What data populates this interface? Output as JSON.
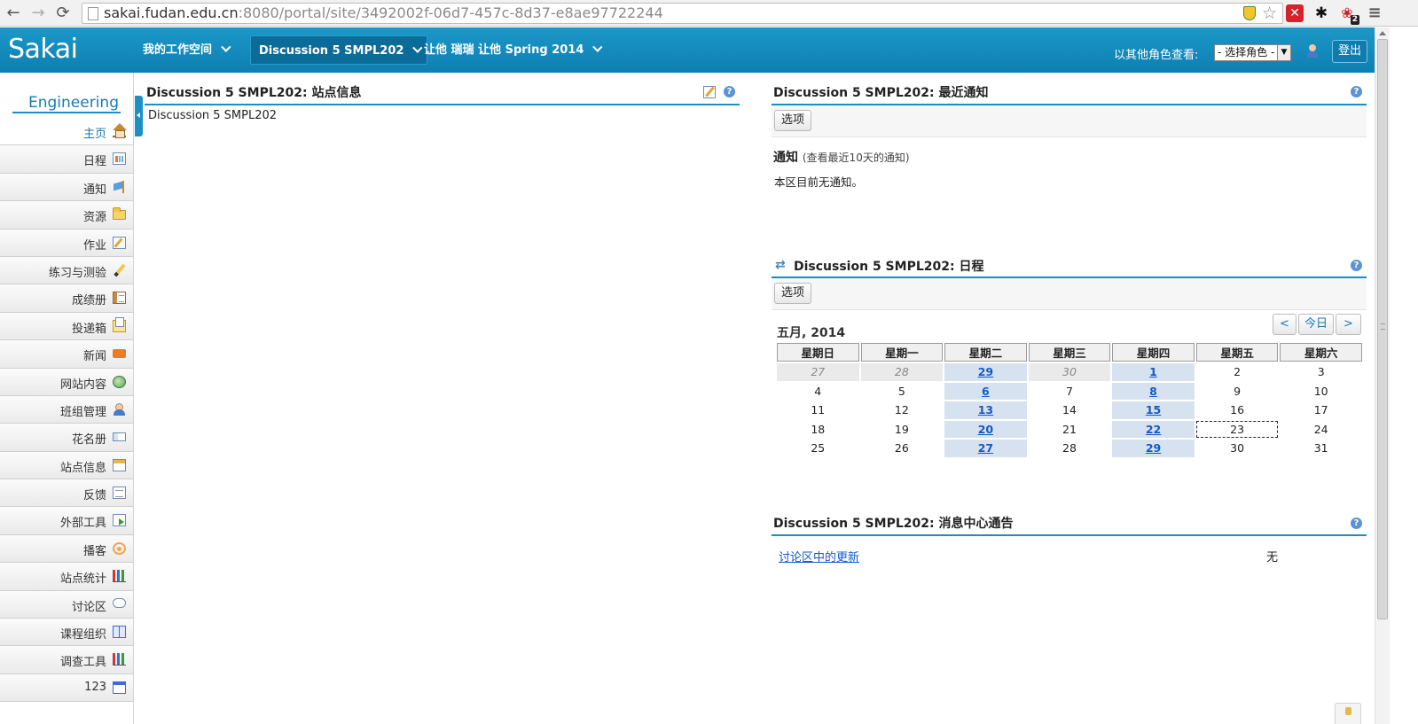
{
  "browser": {
    "url_host": "sakai.fudan.edu.cn",
    "url_rest": ":8080/portal/site/3492002f-06d7-457c-8d37-e8ae97722244",
    "ext_badge": "2"
  },
  "header": {
    "logo": "Sakai",
    "tabs": [
      {
        "label": "我的工作空间"
      },
      {
        "label": "Discussion 5 SMPL202"
      },
      {
        "label": "让他 瑞瑞 让他 Spring 2014"
      }
    ],
    "role_label": "以其他角色查看:",
    "role_select": "- 选择角色 -",
    "logout": "登出"
  },
  "sidebar": {
    "site_title": "Engineering",
    "items": [
      {
        "label": "主页",
        "icon": "home-icon"
      },
      {
        "label": "日程",
        "icon": "calendar-icon"
      },
      {
        "label": "通知",
        "icon": "announcement-icon"
      },
      {
        "label": "资源",
        "icon": "folder-icon"
      },
      {
        "label": "作业",
        "icon": "assignment-icon"
      },
      {
        "label": "练习与测验",
        "icon": "pencil-icon"
      },
      {
        "label": "成绩册",
        "icon": "gradebook-icon"
      },
      {
        "label": "投递箱",
        "icon": "dropbox-icon"
      },
      {
        "label": "新闻",
        "icon": "rss-icon"
      },
      {
        "label": "网站内容",
        "icon": "globe-icon"
      },
      {
        "label": "班组管理",
        "icon": "group-icon"
      },
      {
        "label": "花名册",
        "icon": "roster-icon"
      },
      {
        "label": "站点信息",
        "icon": "site-info-icon"
      },
      {
        "label": "反馈",
        "icon": "feedback-icon"
      },
      {
        "label": "外部工具",
        "icon": "external-tool-icon"
      },
      {
        "label": "播客",
        "icon": "podcast-icon"
      },
      {
        "label": "站点统计",
        "icon": "stats-icon"
      },
      {
        "label": "讨论区",
        "icon": "forum-icon"
      },
      {
        "label": "课程组织",
        "icon": "lessons-icon"
      },
      {
        "label": "调查工具",
        "icon": "poll-icon"
      },
      {
        "label": "123",
        "icon": "web-content-icon"
      }
    ]
  },
  "site_info": {
    "title": "Discussion 5 SMPL202: 站点信息",
    "description": "Discussion 5 SMPL202"
  },
  "announcements": {
    "title": "Discussion 5 SMPL202: 最近通知",
    "options": "选项",
    "heading": "通知",
    "subheading": "(查看最近10天的通知)",
    "empty": "本区目前无通知。"
  },
  "calendar": {
    "title": "Discussion 5 SMPL202: 日程",
    "options": "选项",
    "month": "五月, 2014",
    "prev": "<",
    "today": "今日",
    "next": ">",
    "weekdays": [
      "星期日",
      "星期一",
      "星期二",
      "星期三",
      "星期四",
      "星期五",
      "星期六"
    ],
    "weeks": [
      [
        {
          "d": "27",
          "t": "other"
        },
        {
          "d": "28",
          "t": "other"
        },
        {
          "d": "29",
          "t": "event"
        },
        {
          "d": "30",
          "t": "other"
        },
        {
          "d": "1",
          "t": "event"
        },
        {
          "d": "2",
          "t": ""
        },
        {
          "d": "3",
          "t": ""
        }
      ],
      [
        {
          "d": "4",
          "t": ""
        },
        {
          "d": "5",
          "t": ""
        },
        {
          "d": "6",
          "t": "event"
        },
        {
          "d": "7",
          "t": ""
        },
        {
          "d": "8",
          "t": "event"
        },
        {
          "d": "9",
          "t": ""
        },
        {
          "d": "10",
          "t": ""
        }
      ],
      [
        {
          "d": "11",
          "t": ""
        },
        {
          "d": "12",
          "t": ""
        },
        {
          "d": "13",
          "t": "event"
        },
        {
          "d": "14",
          "t": ""
        },
        {
          "d": "15",
          "t": "event"
        },
        {
          "d": "16",
          "t": ""
        },
        {
          "d": "17",
          "t": ""
        }
      ],
      [
        {
          "d": "18",
          "t": ""
        },
        {
          "d": "19",
          "t": ""
        },
        {
          "d": "20",
          "t": "event"
        },
        {
          "d": "21",
          "t": ""
        },
        {
          "d": "22",
          "t": "event"
        },
        {
          "d": "23",
          "t": "today"
        },
        {
          "d": "24",
          "t": ""
        }
      ],
      [
        {
          "d": "25",
          "t": ""
        },
        {
          "d": "26",
          "t": ""
        },
        {
          "d": "27",
          "t": "event"
        },
        {
          "d": "28",
          "t": ""
        },
        {
          "d": "29",
          "t": "event"
        },
        {
          "d": "30",
          "t": ""
        },
        {
          "d": "31",
          "t": ""
        }
      ]
    ]
  },
  "messages": {
    "title": "Discussion 5 SMPL202: 消息中心通告",
    "link": "讨论区中的更新",
    "value": "无"
  },
  "colors": {
    "header": "#0d7fb1",
    "accent_rule": "#1a8fc3",
    "event_cell": "#d6e2f0"
  }
}
